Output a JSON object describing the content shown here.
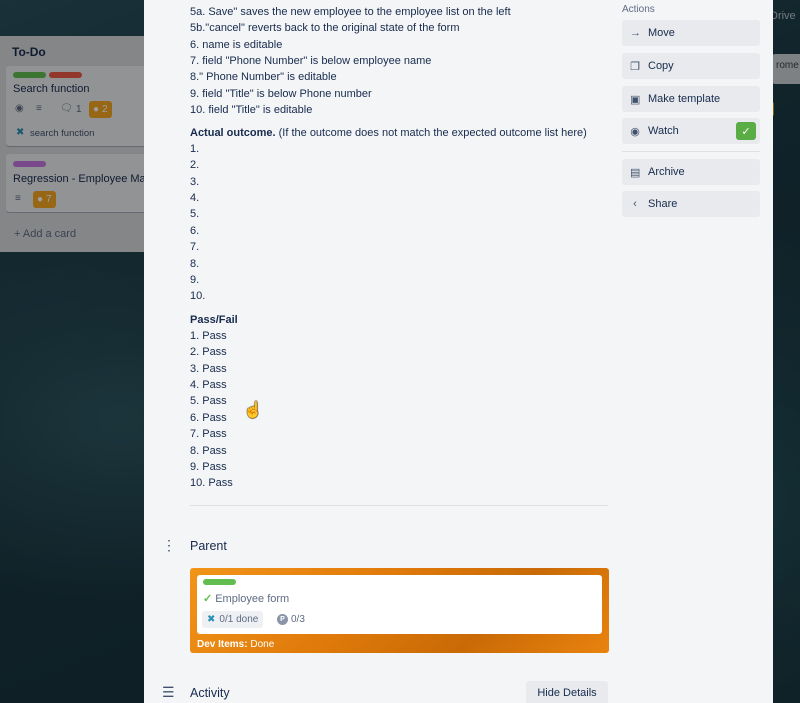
{
  "board": {
    "top_right_text": "Drive",
    "right_card_text": "rome"
  },
  "list": {
    "title": "To-Do",
    "cards": [
      {
        "title": "Search function",
        "comment_count": "1",
        "badge_count": "2",
        "task_link": "search function",
        "labels": [
          "#61bd4f",
          "#eb5a46"
        ]
      },
      {
        "title": "Regression - Employee Ma",
        "badge_count": "7",
        "labels": [
          "#c377e0"
        ]
      }
    ],
    "add_card": "Add a card"
  },
  "description": {
    "steps": [
      "5a. Save\" saves the new employee to the employee list on the left",
      "5b.\"cancel\" reverts back to the original state of the form",
      "6. name is editable",
      "7. field \"Phone Number\" is below employee name",
      "8.\" Phone Number\" is editable",
      "9. field \"Title\" is below Phone number",
      "10. field \"Title\" is editable"
    ],
    "actual_outcome_heading": "Actual outcome.",
    "actual_outcome_note": " (If the outcome does not match the expected outcome list here)",
    "actual_outcome_items": [
      "1.",
      "2.",
      "3.",
      "4.",
      "5.",
      "6.",
      "7.",
      "8.",
      "9.",
      "10."
    ],
    "pass_fail_heading": "Pass/Fail",
    "pass_fail_items": [
      "1. Pass",
      "2. Pass",
      "3. Pass",
      "4. Pass",
      "5. Pass",
      "6. Pass",
      "7. Pass",
      "8. Pass",
      "9. Pass",
      "10. Pass"
    ]
  },
  "parent": {
    "heading": "Parent",
    "card_title": "Employee form",
    "checklist": "0/1 done",
    "p_count": "0/3",
    "footer_label": "Dev Items:",
    "footer_value": " Done",
    "label_color": "#61bd4f"
  },
  "activity": {
    "heading": "Activity",
    "hide_details": "Hide Details"
  },
  "actions": {
    "title": "Actions",
    "buttons": [
      {
        "label": "Move",
        "icon": "arrow-right-icon"
      },
      {
        "label": "Copy",
        "icon": "copy-icon"
      },
      {
        "label": "Make template",
        "icon": "template-icon"
      },
      {
        "label": "Watch",
        "icon": "eye-icon"
      },
      {
        "label": "Archive",
        "icon": "archive-icon"
      },
      {
        "label": "Share",
        "icon": "share-icon"
      }
    ],
    "watch_active_color": "#5aac44"
  }
}
